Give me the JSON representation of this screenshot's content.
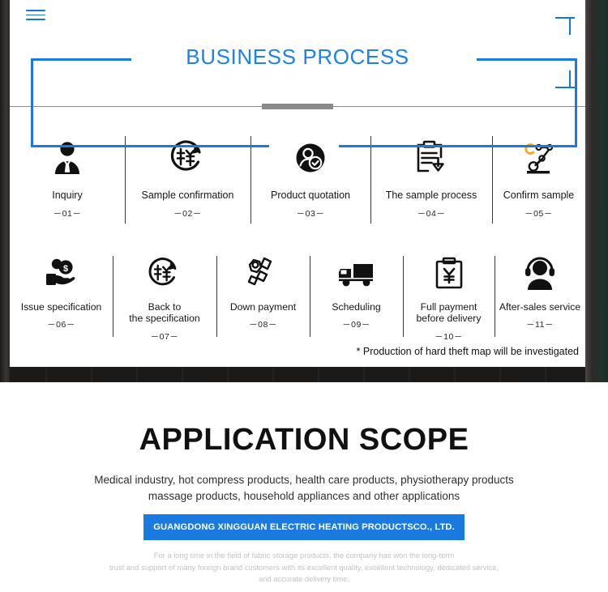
{
  "top": {
    "menu_icon": "hamburger-icon",
    "title": "BUSINESS PROCESS",
    "footnote": "* Production of hard theft map will be investigated",
    "accent_color": "#1a80f5",
    "divider_color": "#8a8a8a"
  },
  "process": {
    "row1": [
      {
        "icon": "businessman-icon",
        "label": "Inquiry",
        "number": "－01－"
      },
      {
        "icon": "sample-recycle-icon",
        "label": "Sample confirmation",
        "number": "－02－"
      },
      {
        "icon": "user-check-circle-icon",
        "label": "Product quotation",
        "number": "－03－"
      },
      {
        "icon": "clipboard-download-icon",
        "label": "The sample process",
        "number": "－04－"
      },
      {
        "icon": "robot-arm-icon",
        "label": "Confirm sample",
        "number": "－05－"
      }
    ],
    "row2": [
      {
        "icon": "hand-money-icon",
        "label": "Issue specification",
        "number": "－06－"
      },
      {
        "icon": "sample-recycle-icon",
        "label": "Back to\nthe specification",
        "number": "－07－"
      },
      {
        "icon": "coins-icon",
        "label": "Down payment",
        "number": "－08－"
      },
      {
        "icon": "truck-icon",
        "label": "Scheduling",
        "number": "－09－"
      },
      {
        "icon": "clipboard-yen-icon",
        "label": "Full payment\nbefore delivery",
        "number": "－10－"
      },
      {
        "icon": "headset-person-icon",
        "label": "After-sales service",
        "number": "－11－"
      }
    ]
  },
  "scope": {
    "title": "APPLICATION SCOPE",
    "description_line1": "Medical industry, hot compress products, health care products, physiotherapy products",
    "description_line2": "massage products, household appliances and other applications",
    "company_button": "GUANGDONG XINGGUAN ELECTRIC HEATING PRODUCTSCO., LTD.",
    "frame_color": "#1a7ae0",
    "button_color": "#1a7ae0"
  },
  "footer": {
    "line1": "For a long time in the field of fabric storage products, the company has won the long-term",
    "line2": "trust and support of many foreign brand customers with its excellent quality, excellent technology, dedicated service,",
    "line3": "and accurate delivery time."
  }
}
